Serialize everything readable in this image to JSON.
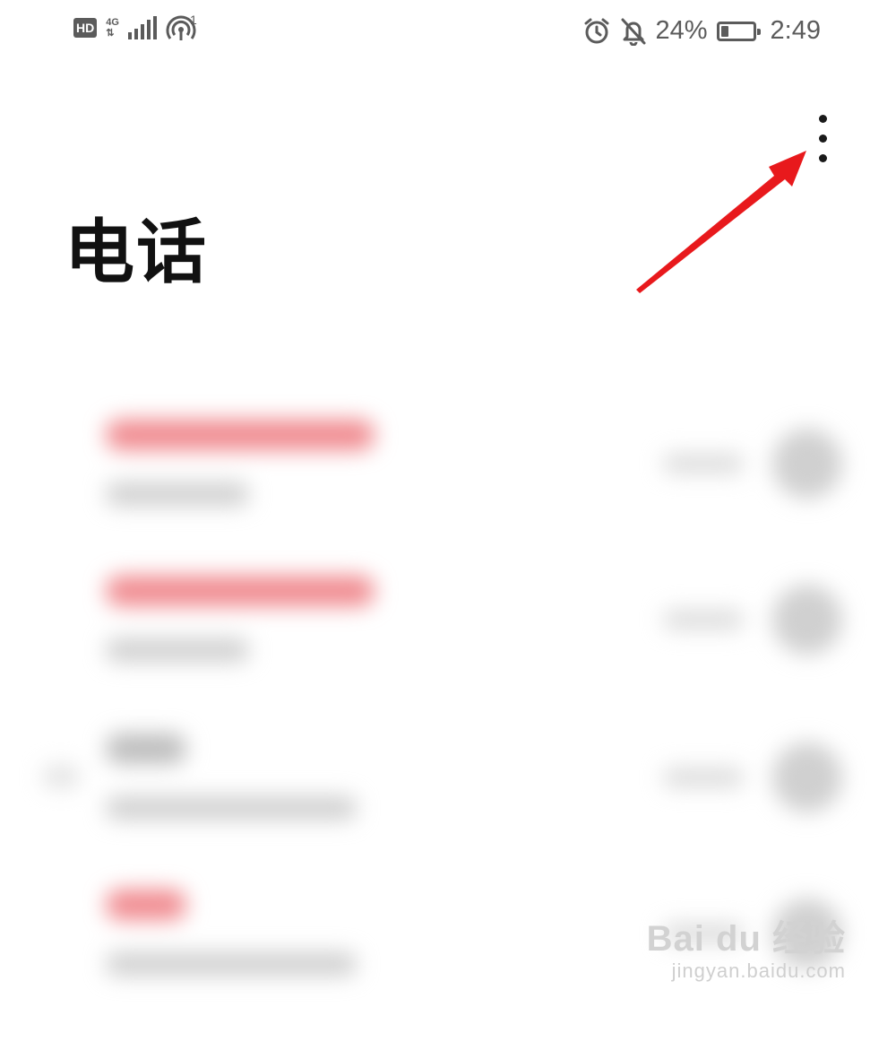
{
  "status_bar": {
    "hd_label": "HD",
    "network_type": "4G",
    "hotspot_count": "1",
    "battery_percent": "24%",
    "battery_level": 0.24,
    "time": "2:49",
    "icons": [
      "hd-icon",
      "signal-icon",
      "hotspot-icon",
      "alarm-icon",
      "bell-off-icon",
      "battery-icon"
    ]
  },
  "header": {
    "title": "电话",
    "more_icon": "more-vertical-icon"
  },
  "annotation": {
    "arrow_color": "#e8191c",
    "points_to": "more-button"
  },
  "call_log": {
    "blurred": true,
    "colors": {
      "missed": "#f08a8f",
      "normal": "#bdbdbd"
    },
    "items": [
      {
        "status": "missed"
      },
      {
        "status": "missed"
      },
      {
        "status": "normal"
      },
      {
        "status": "missed"
      }
    ]
  },
  "watermark": {
    "logo": "Bai du 经验",
    "url": "jingyan.baidu.com"
  }
}
